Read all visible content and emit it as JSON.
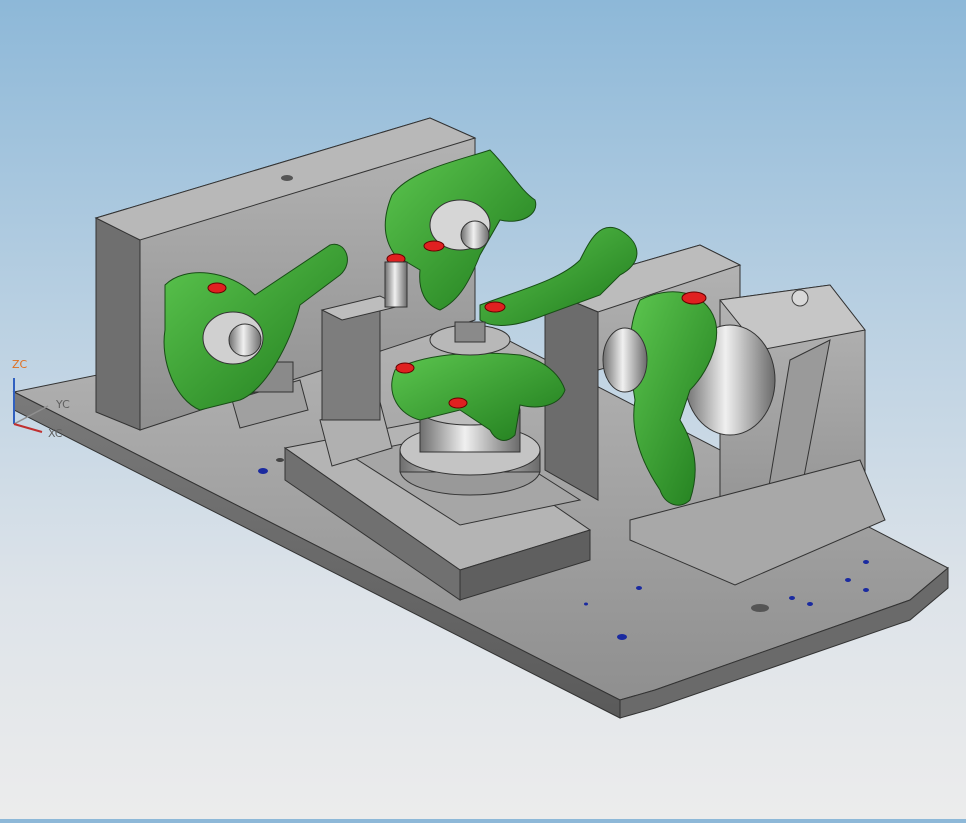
{
  "viewport": {
    "background_top": "#8db8d8",
    "background_bottom": "#ececec"
  },
  "colors": {
    "fixture_gray": "#8c8c8c",
    "fixture_light": "#c8c8c8",
    "part_green": "#2f9a2a",
    "part_green_light": "#5cc64f",
    "marker_red": "#e02020",
    "hole_blue": "#1a2aa0"
  },
  "triad": {
    "z_label": "ZC",
    "y_label": "YC",
    "x_label": "XC",
    "z_color": "#e07020",
    "y_color": "#606060",
    "x_color": "#606060"
  },
  "model": {
    "icon": "cad-assembly-icon"
  }
}
